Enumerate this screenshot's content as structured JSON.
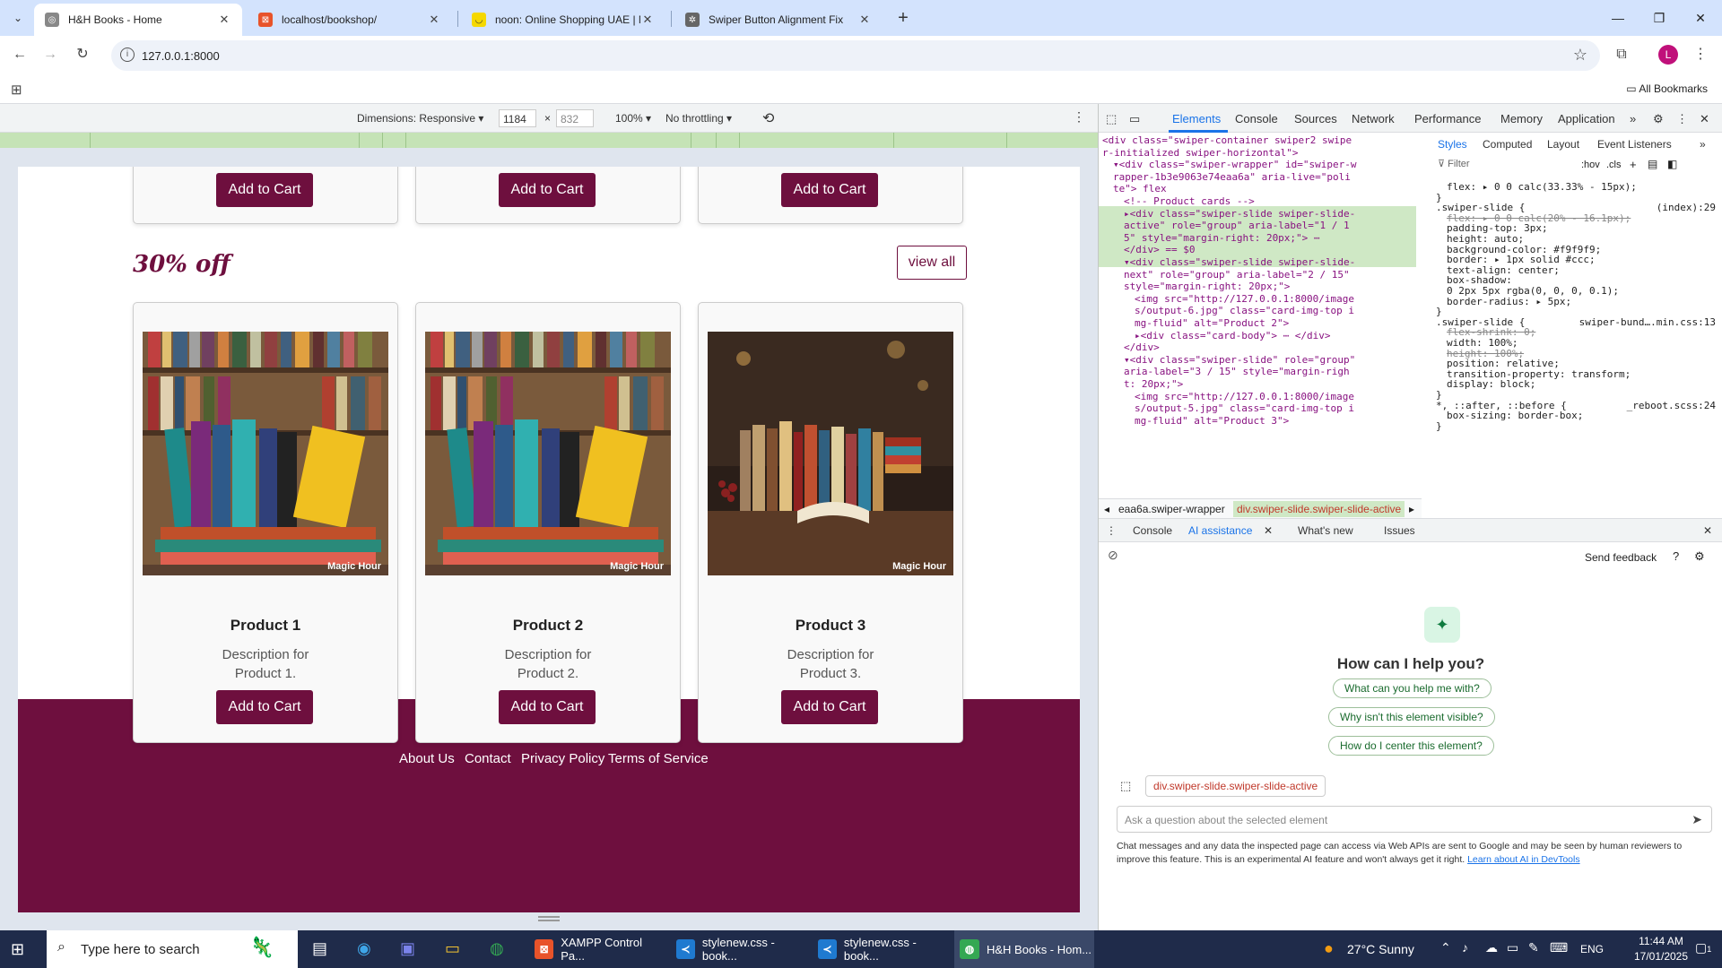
{
  "browser": {
    "tabs": [
      {
        "title": "H&H Books - Home",
        "active": true
      },
      {
        "title": "localhost/bookshop/",
        "active": false
      },
      {
        "title": "noon: Online Shopping UAE | M",
        "active": false
      },
      {
        "title": "Swiper Button Alignment Fix",
        "active": false
      }
    ],
    "url": "127.0.0.1:8000",
    "profile_initial": "L",
    "all_bookmarks": "All Bookmarks"
  },
  "device_toolbar": {
    "dimensions_label": "Dimensions: Responsive",
    "width": "1184",
    "times": "×",
    "height": "832",
    "zoom": "100%",
    "throttling": "No throttling"
  },
  "page": {
    "top_buttons": [
      "Add to Cart",
      "Add to Cart",
      "Add to Cart"
    ],
    "section_title": "30% off",
    "view_all": "view all",
    "products": [
      {
        "name": "Product 1",
        "desc1": "Description for",
        "desc2": "Product 1.",
        "button": "Add to Cart",
        "watermark": "Magic Hour"
      },
      {
        "name": "Product 2",
        "desc1": "Description for",
        "desc2": "Product 2.",
        "button": "Add to Cart",
        "watermark": "Magic Hour"
      },
      {
        "name": "Product 3",
        "desc1": "Description for",
        "desc2": "Product 3.",
        "button": "Add to Cart",
        "watermark": "Magic Hour"
      }
    ],
    "footer_links": [
      "About Us",
      "Contact",
      "Privacy Policy",
      "Terms of Service"
    ]
  },
  "devtools": {
    "tabs": [
      "Elements",
      "Console",
      "Sources",
      "Network",
      "Performance",
      "Memory",
      "Application"
    ],
    "dom_lines": [
      {
        "indent": 0,
        "text": "<div class=\"swiper-container swiper2 swipe"
      },
      {
        "indent": 0,
        "text": "r-initialized swiper-horizontal\">"
      },
      {
        "indent": 1,
        "text": "▾<div class=\"swiper-wrapper\" id=\"swiper-w"
      },
      {
        "indent": 1,
        "text": "rapper-1b3e9063e74eaa6a\" aria-live=\"poli"
      },
      {
        "indent": 1,
        "text": "te\">  flex"
      },
      {
        "indent": 2,
        "text": "<!-- Product cards -->"
      },
      {
        "indent": 2,
        "text": "▸<div class=\"swiper-slide swiper-slide-"
      },
      {
        "indent": 2,
        "text": "active\" role=\"group\" aria-label=\"1 / 1"
      },
      {
        "indent": 2,
        "text": "5\" style=\"margin-right: 20px;\"> ⋯"
      },
      {
        "indent": 2,
        "text": "</div> == $0"
      },
      {
        "indent": 2,
        "text": "▾<div class=\"swiper-slide swiper-slide-"
      },
      {
        "indent": 2,
        "text": "next\" role=\"group\" aria-label=\"2 / 15\""
      },
      {
        "indent": 2,
        "text": "style=\"margin-right: 20px;\">"
      },
      {
        "indent": 3,
        "text": "<img src=\"http://127.0.0.1:8000/image"
      },
      {
        "indent": 3,
        "text": "s/output-6.jpg\" class=\"card-img-top i"
      },
      {
        "indent": 3,
        "text": "mg-fluid\" alt=\"Product 2\">"
      },
      {
        "indent": 3,
        "text": "▸<div class=\"card-body\"> ⋯ </div>"
      },
      {
        "indent": 2,
        "text": "</div>"
      },
      {
        "indent": 2,
        "text": "▾<div class=\"swiper-slide\" role=\"group\""
      },
      {
        "indent": 2,
        "text": "aria-label=\"3 / 15\" style=\"margin-righ"
      },
      {
        "indent": 2,
        "text": "t: 20px;\">"
      },
      {
        "indent": 3,
        "text": "<img src=\"http://127.0.0.1:8000/image"
      },
      {
        "indent": 3,
        "text": "s/output-5.jpg\" class=\"card-img-top i"
      },
      {
        "indent": 3,
        "text": "mg-fluid\" alt=\"Product 3\">"
      }
    ],
    "breadcrumbs": [
      "eaa6a.swiper-wrapper",
      "div.swiper-slide.swiper-slide-active"
    ],
    "styles_tabs": [
      "Styles",
      "Computed",
      "Layout",
      "Event Listeners"
    ],
    "filter_placeholder": "Filter",
    "hov": ":hov",
    "cls": ".cls",
    "style_lines": [
      {
        "text": "flex: ▸ 0 0 calc(33.33% - 15px);"
      },
      {
        "text": "}"
      },
      {
        "text": ".swiper-slide {",
        "src": "(index):29"
      },
      {
        "text": "flex: ▸ 0 0 calc(20% - 16.1px);",
        "struck": true
      },
      {
        "text": "padding-top: 3px;"
      },
      {
        "text": "height: auto;"
      },
      {
        "text": "background-color: #f9f9f9;"
      },
      {
        "text": "border: ▸ 1px solid #ccc;"
      },
      {
        "text": "text-align: center;"
      },
      {
        "text": "box-shadow:"
      },
      {
        "text": "  0 2px 5px rgba(0, 0, 0, 0.1);"
      },
      {
        "text": "border-radius: ▸ 5px;"
      },
      {
        "text": "}"
      },
      {
        "text": ".swiper-slide {",
        "src": "swiper-bund….min.css:13"
      },
      {
        "text": "flex-shrink: 0;",
        "struck": true
      },
      {
        "text": "width: 100%;"
      },
      {
        "text": "height: 100%;",
        "struck": true
      },
      {
        "text": "position: relative;"
      },
      {
        "text": "transition-property: transform;"
      },
      {
        "text": "display: block;"
      },
      {
        "text": "}"
      },
      {
        "text": "*, ::after, ::before {",
        "src": "_reboot.scss:24"
      },
      {
        "text": "box-sizing: border-box;"
      },
      {
        "text": "}"
      }
    ],
    "drawer_tabs": [
      "Console",
      "AI assistance",
      "What's new",
      "Issues"
    ],
    "send_feedback": "Send feedback",
    "ai_question": "How can I help you?",
    "suggestions": [
      "What can you help me with?",
      "Why isn't this element visible?",
      "How do I center this element?"
    ],
    "context_chip": "div.swiper-slide.swiper-slide-active",
    "ask_placeholder": "Ask a question about the selected element",
    "disclaimer": "Chat messages and any data the inspected page can access via Web APIs are sent to Google and may be seen by human reviewers to improve this feature. This is an experimental AI feature and won't always get it right.",
    "disclaimer_link": "Learn about AI in DevTools"
  },
  "taskbar": {
    "search_placeholder": "Type here to search",
    "apps": [
      {
        "label": "XAMPP Control Pa...",
        "icon": "xampp"
      },
      {
        "label": "stylenew.css - book...",
        "icon": "vscode"
      },
      {
        "label": "stylenew.css - book...",
        "icon": "vscode"
      },
      {
        "label": "H&H Books - Hom...",
        "icon": "chrome"
      }
    ],
    "weather": "27°C  Sunny",
    "language": "ENG",
    "time": "11:44 AM",
    "date": "17/01/2025",
    "notification_count": "1"
  }
}
